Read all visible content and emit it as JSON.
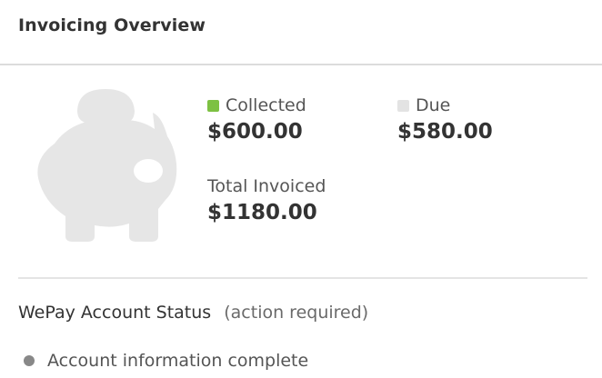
{
  "header": {
    "title": "Invoicing Overview"
  },
  "illustration": {
    "icon": "piggy-bank-icon",
    "color": "#e6e6e6"
  },
  "stats": {
    "collected": {
      "label": "Collected",
      "value": "$600.00",
      "color": "#7dc142"
    },
    "due": {
      "label": "Due",
      "value": "$580.00",
      "color": "#e3e3e3"
    },
    "total": {
      "label": "Total Invoiced",
      "value": "$1180.00"
    }
  },
  "account_status": {
    "title": "WePay Account Status",
    "note": "(action required)",
    "items": [
      {
        "label": "Account information complete",
        "bullet_color": "#888888"
      }
    ]
  }
}
